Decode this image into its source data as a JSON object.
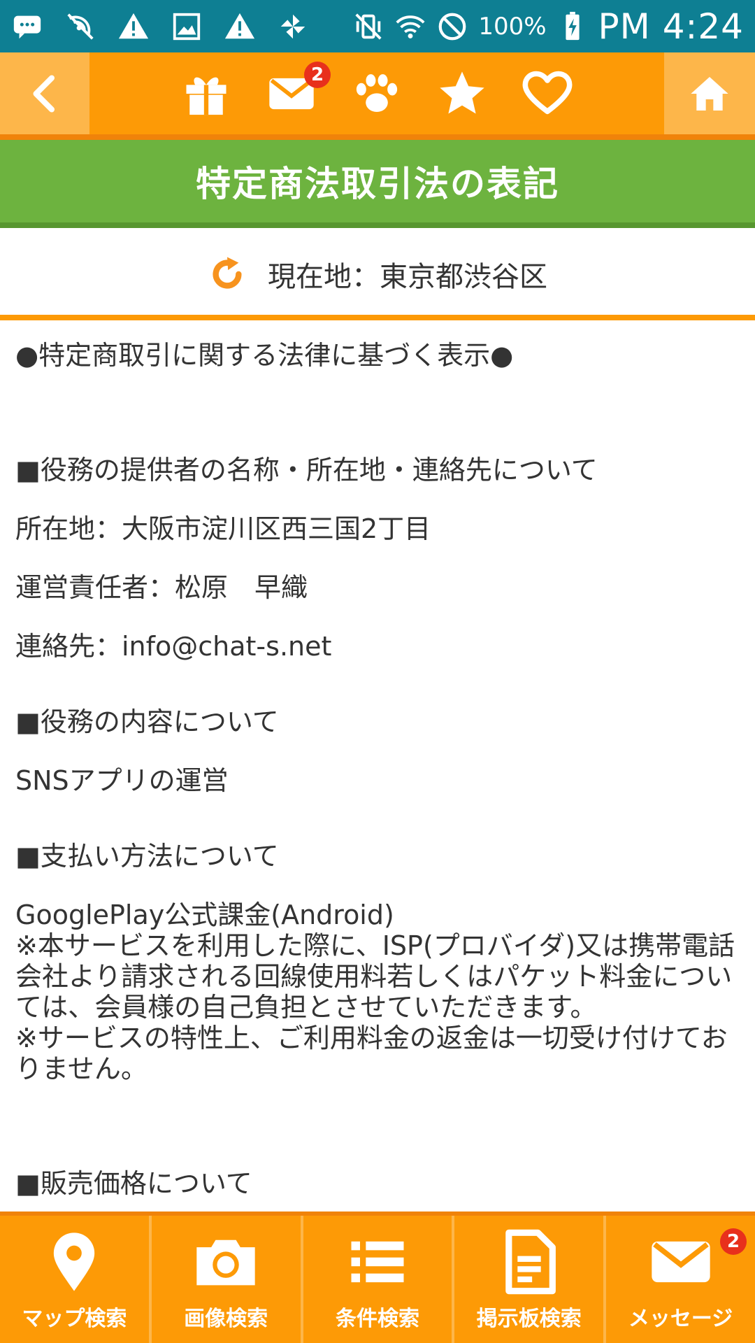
{
  "status_bar": {
    "battery_percent": "100%",
    "time": "PM 4:24",
    "icons": [
      "chat-icon",
      "signal-off-icon",
      "warning-icon",
      "image-icon",
      "warning-icon",
      "pinwheel-icon",
      "vibrate-mute-icon",
      "wifi-icon",
      "blocked-icon",
      "battery-charging-icon"
    ]
  },
  "top_nav": {
    "back_icon": "chevron-left-icon",
    "home_icon": "home-icon",
    "mail_badge": "2",
    "icons": [
      "gift-icon",
      "mail-icon",
      "paw-icon",
      "star-icon",
      "heart-icon"
    ]
  },
  "page": {
    "title": "特定商法取引法の表記"
  },
  "location": {
    "icon": "refresh-icon",
    "text": "現在地：東京都渋谷区"
  },
  "content": {
    "heading_main": "●特定商取引に関する法律に基づく表示●",
    "section1_title": "■役務の提供者の名称・所在地・連絡先について",
    "address": "所在地：大阪市淀川区西三国2丁目",
    "manager": "運営責任者：松原　早織",
    "contact": "連絡先：info@chat-s.net",
    "section2_title": "■役務の内容について",
    "service": "SNSアプリの運営",
    "section3_title": "■支払い方法について",
    "payment": "GooglePlay公式課金(Android)",
    "note1": "※本サービスを利用した際に、ISP(プロバイダ)又は携帯電話会社より請求される回線使用料若しくはパケット料金については、会員様の自己負担とさせていただきます。",
    "note2": "※サービスの特性上、ご利用料金の返金は一切受け付けておりません。",
    "section4_title": "■販売価格について"
  },
  "bottom_nav": {
    "tabs": [
      {
        "label": "マップ検索",
        "icon": "map-pin-icon"
      },
      {
        "label": "画像検索",
        "icon": "camera-icon"
      },
      {
        "label": "条件検索",
        "icon": "list-icon"
      },
      {
        "label": "掲示板検索",
        "icon": "document-icon"
      },
      {
        "label": "メッセージ",
        "icon": "mail-icon"
      }
    ],
    "message_badge": "2"
  },
  "colors": {
    "status_bar": "#0e7f93",
    "nav_orange": "#fd9a06",
    "nav_light_orange": "#fdb64a",
    "title_green": "#6db33f",
    "badge_red": "#e8301c",
    "text": "#333333"
  }
}
